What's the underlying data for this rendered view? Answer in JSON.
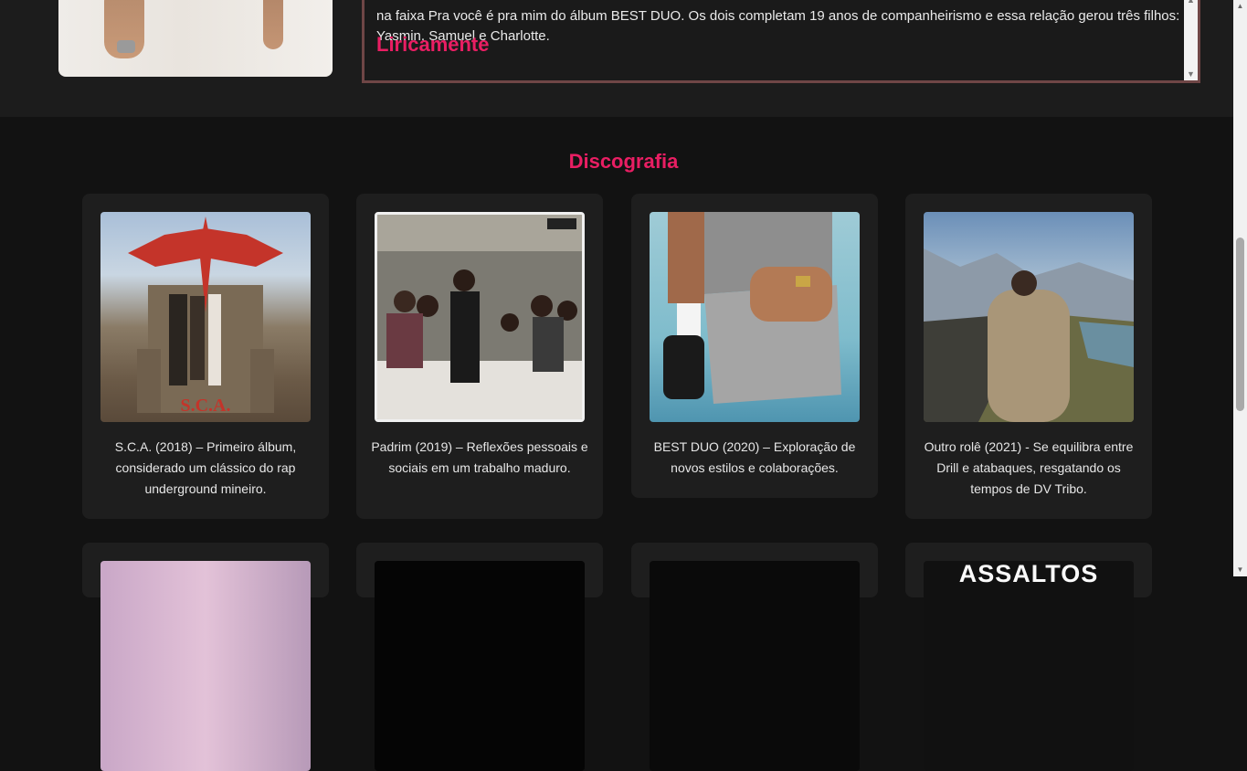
{
  "bio": {
    "text": "na faixa Pra você é pra mim do álbum BEST DUO. Os dois completam 19 anos de companheirismo e essa relação gerou três filhos: Yasmin, Samuel e Charlotte.",
    "heading": "Liricamente"
  },
  "discography": {
    "title": "Discografia",
    "albums": [
      {
        "caption": "S.C.A. (2018) – Primeiro álbum, considerado um clássico do rap underground mineiro."
      },
      {
        "caption": "Padrim (2019) – Reflexões pessoais e sociais em um trabalho maduro."
      },
      {
        "caption": "BEST DUO (2020) – Exploração de novos estilos e colaborações."
      },
      {
        "caption": "Outro rolê (2021) - Se equilibra entre Drill e atabaques, resgatando os tempos de DV Tribo."
      }
    ],
    "next_row_cover_text": "ASSALTOS"
  },
  "colors": {
    "accent": "#e91e63",
    "card_bg": "#1e1e1e",
    "page_bg": "#121212",
    "bio_border": "#6f4646"
  }
}
